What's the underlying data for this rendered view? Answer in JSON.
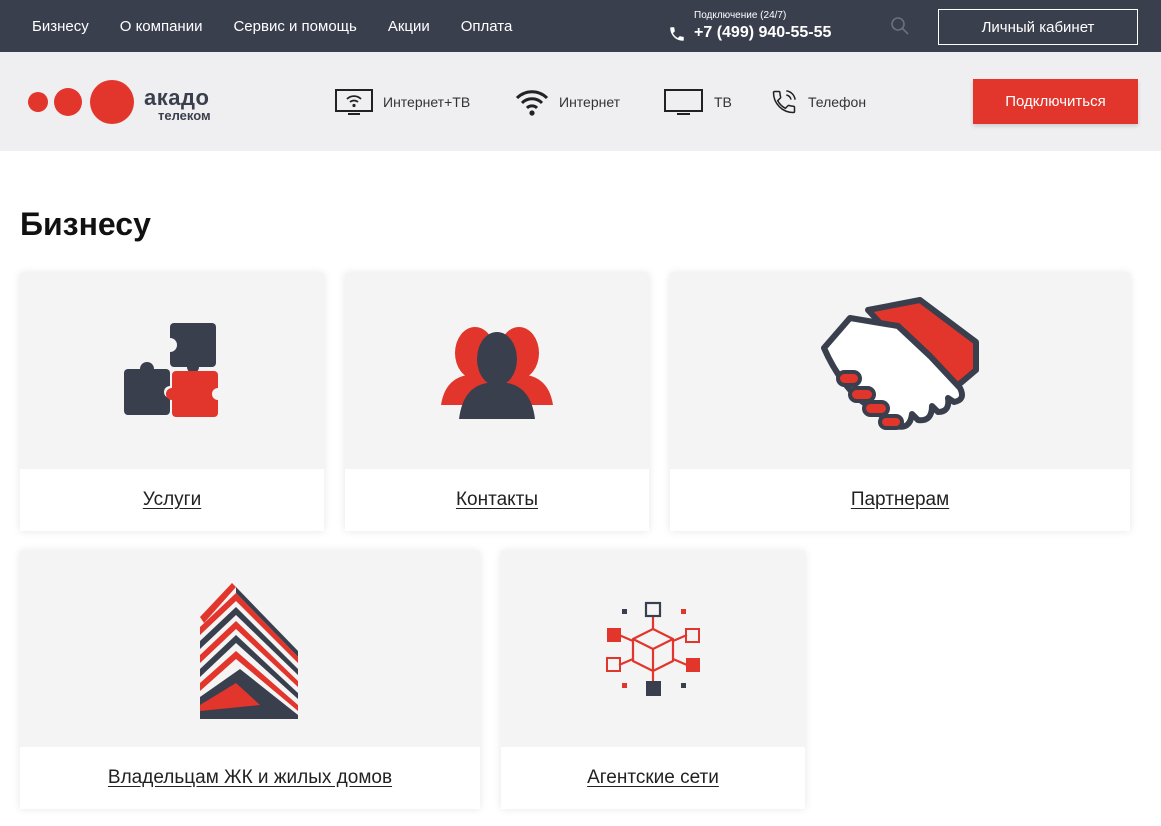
{
  "topbar": {
    "nav": [
      "Бизнесу",
      "О компании",
      "Сервис и помощь",
      "Акции",
      "Оплата"
    ],
    "phone_caption": "Подключение (24/7)",
    "phone_number": "+7 (499) 940-55-55",
    "cabinet_label": "Личный кабинет",
    "bg_color": "#3a3f4e"
  },
  "header": {
    "logo_text": "акадо",
    "logo_sub": "телеком",
    "services": [
      {
        "label": "Интернет+ТВ",
        "icon": "tv-wifi-icon"
      },
      {
        "label": "Интернет",
        "icon": "wifi-icon"
      },
      {
        "label": "ТВ",
        "icon": "tv-icon"
      },
      {
        "label": "Телефон",
        "icon": "phone-icon"
      }
    ],
    "connect_label": "Подключиться",
    "accent_color": "#e2352c"
  },
  "main": {
    "title": "Бизнесу",
    "cards": [
      {
        "label": "Услуги",
        "icon": "puzzle-icon"
      },
      {
        "label": "Контакты",
        "icon": "people-icon"
      },
      {
        "label": "Партнерам",
        "icon": "handshake-icon"
      },
      {
        "label": "Владельцам ЖК и жилых домов",
        "icon": "building-icon"
      },
      {
        "label": "Агентские сети",
        "icon": "network-cube-icon"
      }
    ]
  }
}
